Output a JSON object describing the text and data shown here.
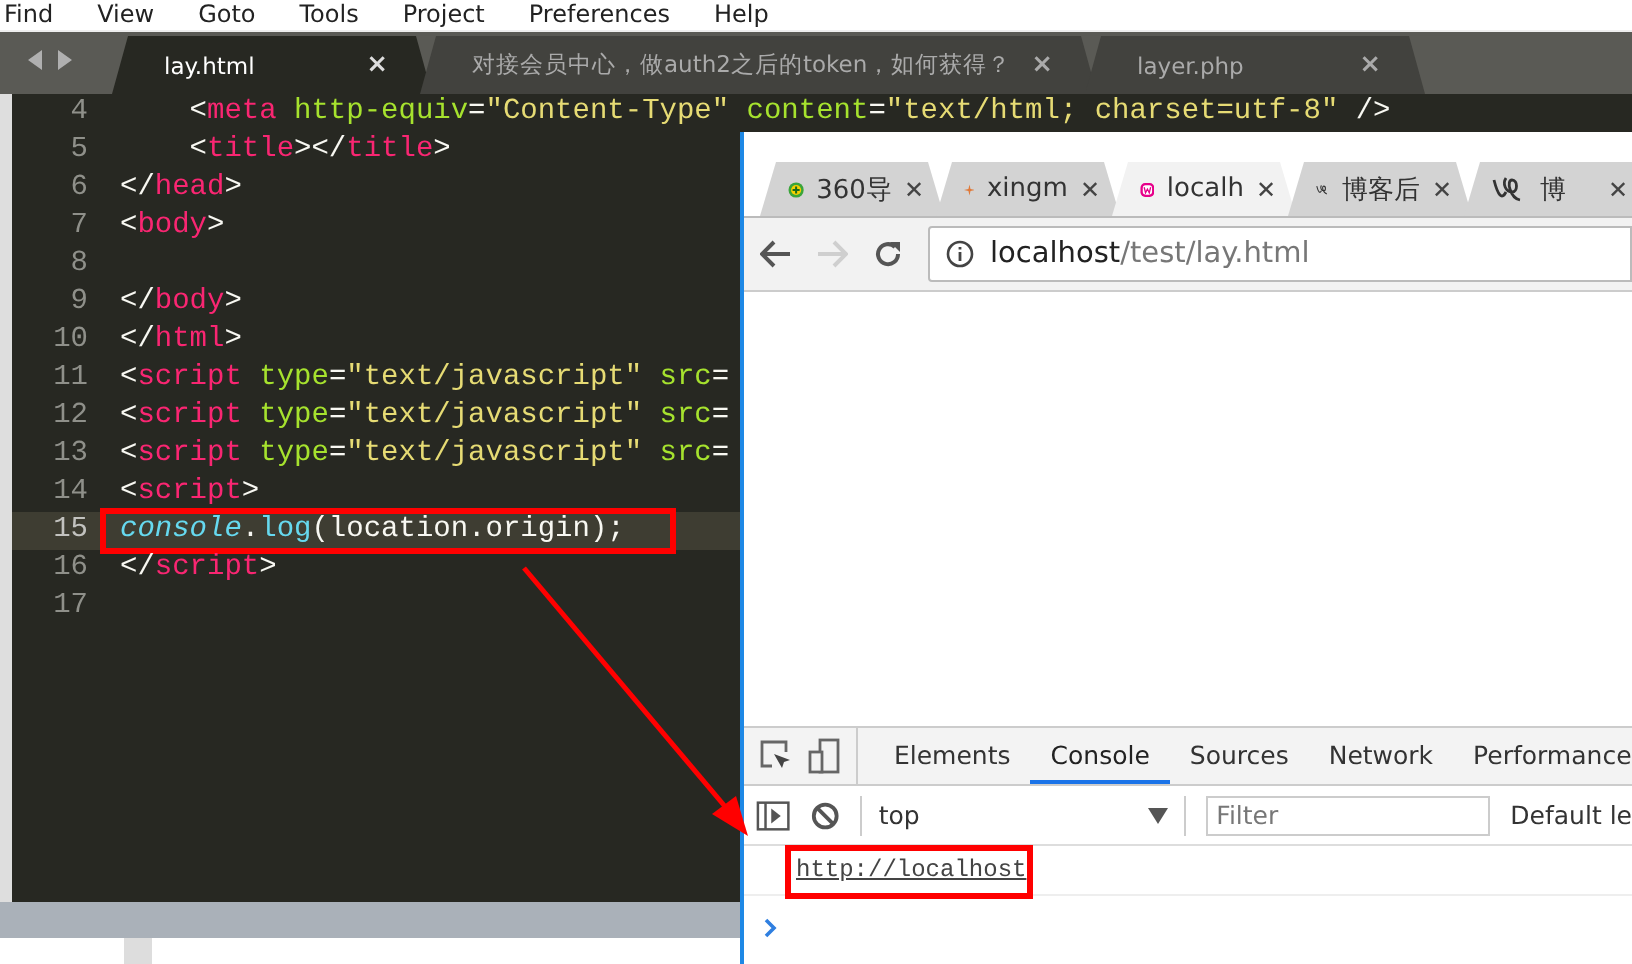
{
  "menu": [
    "Find",
    "View",
    "Goto",
    "Tools",
    "Project",
    "Preferences",
    "Help"
  ],
  "editor": {
    "tabs": [
      {
        "label": "lay.html",
        "close": "×",
        "selected": true
      },
      {
        "label": "对接会员中心，做auth2之后的token，如何获得？",
        "close": "×",
        "selected": false
      },
      {
        "label": "layer.php",
        "close": "×",
        "selected": false
      }
    ],
    "lines": [
      {
        "number": "4",
        "current": false,
        "tokens": [
          {
            "kind": "punct",
            "text": "    <"
          },
          {
            "kind": "tag",
            "text": "meta"
          },
          {
            "kind": "attr",
            "text": " http-equiv"
          },
          {
            "kind": "punct",
            "text": "="
          },
          {
            "kind": "string",
            "text": "\"Content-Type\""
          },
          {
            "kind": "attr",
            "text": " content"
          },
          {
            "kind": "punct",
            "text": "="
          },
          {
            "kind": "string",
            "text": "\"text/html; charset=utf-8\""
          },
          {
            "kind": "punct",
            "text": " />"
          }
        ]
      },
      {
        "number": "5",
        "current": false,
        "tokens": [
          {
            "kind": "punct",
            "text": "    <"
          },
          {
            "kind": "tag",
            "text": "title"
          },
          {
            "kind": "punct",
            "text": "></"
          },
          {
            "kind": "tag",
            "text": "title"
          },
          {
            "kind": "punct",
            "text": ">"
          }
        ]
      },
      {
        "number": "6",
        "current": false,
        "tokens": [
          {
            "kind": "punct",
            "text": "</"
          },
          {
            "kind": "tag",
            "text": "head"
          },
          {
            "kind": "punct",
            "text": ">"
          }
        ]
      },
      {
        "number": "7",
        "current": false,
        "tokens": [
          {
            "kind": "punct",
            "text": "<"
          },
          {
            "kind": "tag",
            "text": "body"
          },
          {
            "kind": "punct",
            "text": ">"
          }
        ]
      },
      {
        "number": "8",
        "current": false
      },
      {
        "number": "9",
        "current": false,
        "tokens": [
          {
            "kind": "punct",
            "text": "</"
          },
          {
            "kind": "tag",
            "text": "body"
          },
          {
            "kind": "punct",
            "text": ">"
          }
        ]
      },
      {
        "number": "10",
        "current": false,
        "tokens": [
          {
            "kind": "punct",
            "text": "</"
          },
          {
            "kind": "tag",
            "text": "html"
          },
          {
            "kind": "punct",
            "text": ">"
          }
        ]
      },
      {
        "number": "11",
        "current": false,
        "tokens": [
          {
            "kind": "punct",
            "text": "<"
          },
          {
            "kind": "tag",
            "text": "script"
          },
          {
            "kind": "attr",
            "text": " type"
          },
          {
            "kind": "punct",
            "text": "="
          },
          {
            "kind": "string",
            "text": "\"text/javascript\""
          },
          {
            "kind": "attr",
            "text": " src"
          },
          {
            "kind": "punct",
            "text": "="
          }
        ]
      },
      {
        "number": "12",
        "current": false,
        "tokens": [
          {
            "kind": "punct",
            "text": "<"
          },
          {
            "kind": "tag",
            "text": "script"
          },
          {
            "kind": "attr",
            "text": " type"
          },
          {
            "kind": "punct",
            "text": "="
          },
          {
            "kind": "string",
            "text": "\"text/javascript\""
          },
          {
            "kind": "attr",
            "text": " src"
          },
          {
            "kind": "punct",
            "text": "="
          }
        ]
      },
      {
        "number": "13",
        "current": false,
        "tokens": [
          {
            "kind": "punct",
            "text": "<"
          },
          {
            "kind": "tag",
            "text": "script"
          },
          {
            "kind": "attr",
            "text": " type"
          },
          {
            "kind": "punct",
            "text": "="
          },
          {
            "kind": "string",
            "text": "\"text/javascript\""
          },
          {
            "kind": "attr",
            "text": " src"
          },
          {
            "kind": "punct",
            "text": "="
          }
        ]
      },
      {
        "number": "14",
        "current": false,
        "tokens": [
          {
            "kind": "punct",
            "text": "<"
          },
          {
            "kind": "tag",
            "text": "script"
          },
          {
            "kind": "punct",
            "text": ">"
          }
        ]
      },
      {
        "number": "15",
        "current": true,
        "tokens": [
          {
            "kind": "object",
            "text": "console"
          },
          {
            "kind": "punct",
            "text": "."
          },
          {
            "kind": "function",
            "text": "log"
          },
          {
            "kind": "punct",
            "text": "(location.origin);"
          }
        ]
      },
      {
        "number": "16",
        "current": false,
        "tokens": [
          {
            "kind": "punct",
            "text": "</"
          },
          {
            "kind": "tag",
            "text": "script"
          },
          {
            "kind": "punct",
            "text": ">"
          }
        ]
      },
      {
        "number": "17",
        "current": false
      }
    ]
  },
  "browser": {
    "tabs": [
      {
        "label": "360导",
        "close": "✕",
        "selected": false
      },
      {
        "label": "xingm",
        "close": "✕",
        "selected": false
      },
      {
        "label": "localh",
        "close": "✕",
        "selected": true
      },
      {
        "label": "博客后",
        "close": "✕",
        "selected": false
      },
      {
        "label": "博",
        "close": "✕",
        "selected": false
      }
    ],
    "forward_disabled": true,
    "address": {
      "host": "localhost",
      "path": "/test/lay.html"
    },
    "devtools": {
      "tabs": [
        {
          "label": "Elements",
          "selected": false
        },
        {
          "label": "Console",
          "selected": true
        },
        {
          "label": "Sources",
          "selected": false
        },
        {
          "label": "Network",
          "selected": false
        },
        {
          "label": "Performance",
          "selected": false
        }
      ],
      "context": "top",
      "filter_placeholder": "Filter",
      "levels": "Default le",
      "log": [
        "http://localhost"
      ]
    }
  }
}
